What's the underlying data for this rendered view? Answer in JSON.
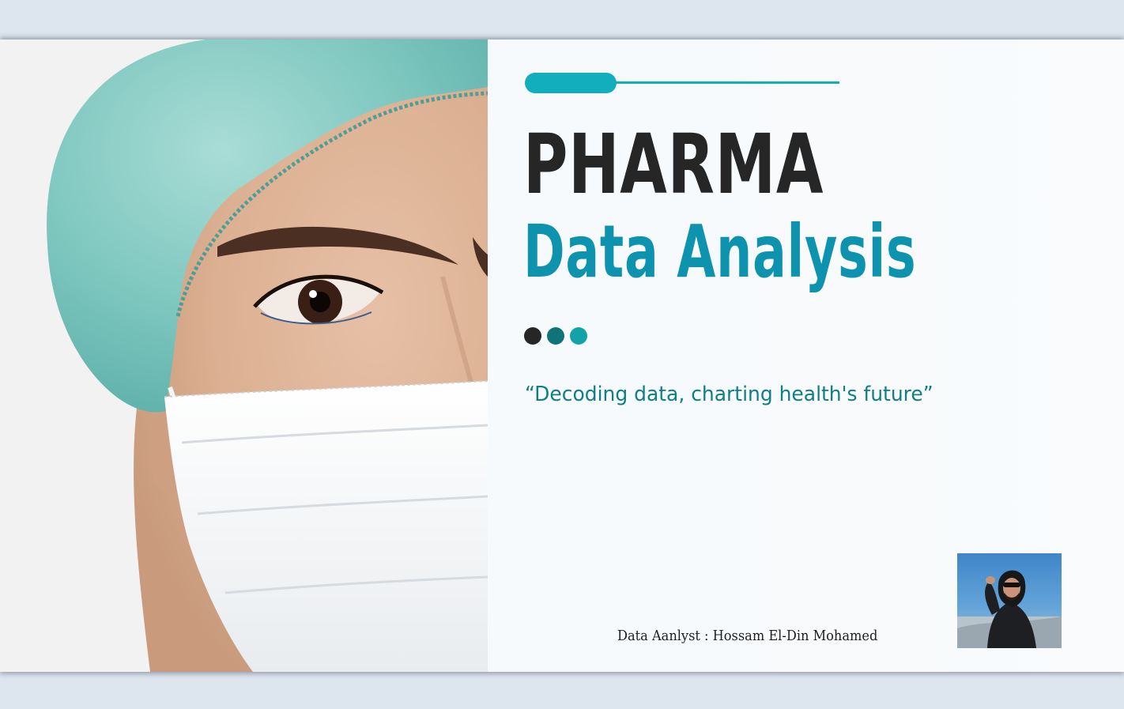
{
  "title": {
    "line1": "PHARMA",
    "line2": "Data Analysis"
  },
  "tagline": "“Decoding data, charting health's future”",
  "author_label": "Data Aanlyst : Hossam El-Din Mohamed",
  "decor": {
    "dot_colors": [
      "#262626",
      "#0f7478",
      "#12a3a8"
    ],
    "accent_color": "#12aebd",
    "title_color": "#262626",
    "subtitle_color": "#0d93ad",
    "tagline_color": "#0f7f85"
  },
  "images": {
    "hero": "healthcare-worker-photo",
    "avatar": "author-portrait-photo"
  }
}
